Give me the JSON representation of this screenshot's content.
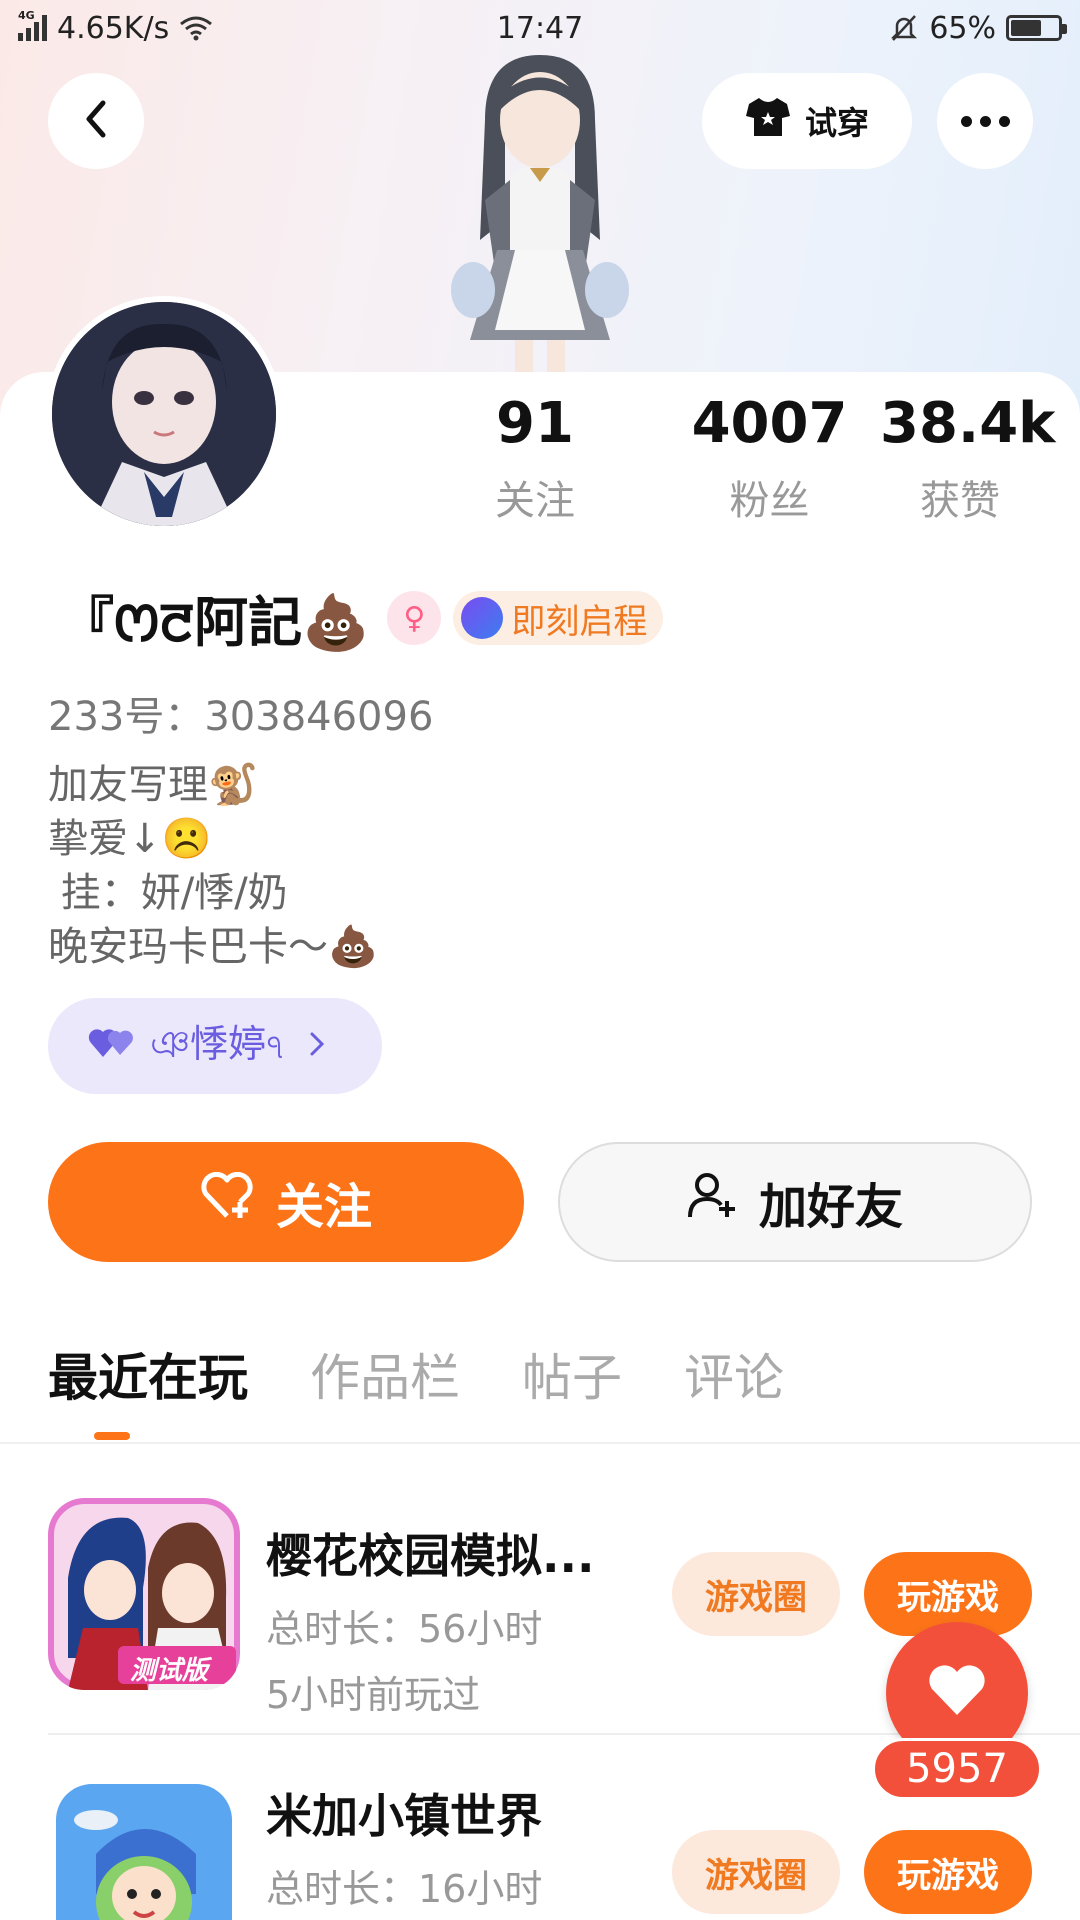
{
  "status_bar": {
    "network": "4G",
    "speed": "4.65K/s",
    "time": "17:47",
    "battery": "65%",
    "battery_level": 0.65
  },
  "header": {
    "tryon_label": "试穿"
  },
  "profile": {
    "stats": [
      {
        "value": "91",
        "label": "关注"
      },
      {
        "value": "4007",
        "label": "粉丝"
      },
      {
        "value": "38.4k",
        "label": "获赞"
      }
    ],
    "name": "『ꯁꯂ阿記💩",
    "gender_symbol": "♀",
    "title_badge": "即刻启程",
    "user_id": "233号：303846096",
    "bio_lines": [
      "加友写理🐒",
      "挚爱↓☹️",
      " 挂：妍/悸/奶",
      "晚安玛卡巴卡～💩"
    ],
    "fan_club_label": "ঞ悸婷ঀ"
  },
  "actions": {
    "follow_label": "关注",
    "add_friend_label": "加好友"
  },
  "tabs": [
    "最近在玩",
    "作品栏",
    "帖子",
    "评论"
  ],
  "games": [
    {
      "title": "樱花校园模拟...",
      "duration": "总时长：56小时",
      "last_played": "5小时前玩过",
      "icon_badge": "测试版",
      "circle_label": "游戏圈",
      "play_label": "玩游戏"
    },
    {
      "title": "米加小镇世界",
      "duration": "总时长：16小时",
      "circle_label": "游戏圈",
      "play_label": "玩游戏"
    }
  ],
  "floating_like": {
    "count": "5957"
  },
  "colors": {
    "accent": "#fd7418",
    "like_red": "#f2503b",
    "fan_club_purple": "#6a5de0"
  }
}
